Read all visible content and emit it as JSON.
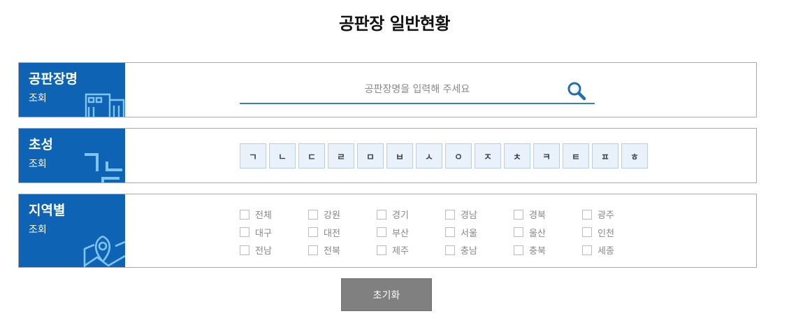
{
  "page_title": "공판장 일반현황",
  "name_panel": {
    "title": "공판장명",
    "subtitle": "조회",
    "placeholder": "공판장명을 입력해 주세요",
    "icon": "search-icon"
  },
  "initial_panel": {
    "title": "초성",
    "subtitle": "조회",
    "initials": [
      "ㄱ",
      "ㄴ",
      "ㄷ",
      "ㄹ",
      "ㅁ",
      "ㅂ",
      "ㅅ",
      "ㅇ",
      "ㅈ",
      "ㅊ",
      "ㅋ",
      "ㅌ",
      "ㅍ",
      "ㅎ"
    ]
  },
  "region_panel": {
    "title": "지역별",
    "subtitle": "조회",
    "regions": [
      "전체",
      "강원",
      "경기",
      "경남",
      "경북",
      "광주",
      "대구",
      "대전",
      "부산",
      "서울",
      "울산",
      "인천",
      "전남",
      "전북",
      "제주",
      "충남",
      "충북",
      "세종"
    ]
  },
  "reset_label": "초기화",
  "colors": {
    "accent": "#0e63b5",
    "search_icon": "#1e6fb8",
    "button_gray": "#808080"
  }
}
